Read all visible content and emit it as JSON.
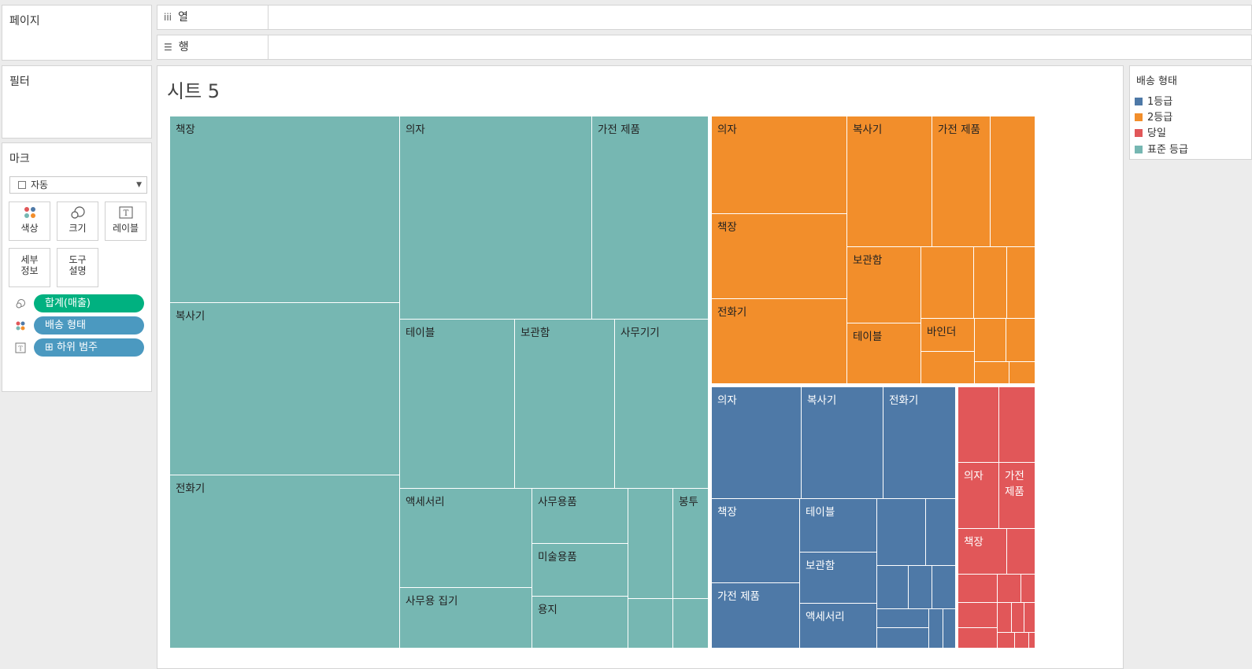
{
  "panels": {
    "pages_title": "페이지",
    "filters_title": "필터",
    "marks_title": "마크"
  },
  "shelves": {
    "columns_label": "열",
    "columns_icon": "iii",
    "rows_label": "행",
    "rows_icon": "☰"
  },
  "marks": {
    "mark_type": "자동",
    "buttons": {
      "color": "색상",
      "size": "크기",
      "label": "레이블",
      "detail_1": "세부",
      "detail_2": "정보",
      "tooltip_1": "도구",
      "tooltip_2": "설명"
    },
    "pills": [
      {
        "icon": "size-icon",
        "text": "합계(매출)",
        "color": "#00b180"
      },
      {
        "icon": "color-icon",
        "text": "배송 형태",
        "color": "#4b99c0"
      },
      {
        "icon": "label-icon",
        "text": "⊞ 하위 범주",
        "color": "#4b99c0"
      }
    ]
  },
  "sheet": {
    "title": "시트 5"
  },
  "legend": {
    "title": "배송 형태",
    "items": [
      {
        "label": "1등급",
        "color": "#4e79a7"
      },
      {
        "label": "2등급",
        "color": "#f28e2b"
      },
      {
        "label": "당일",
        "color": "#e15759"
      },
      {
        "label": "표준 등급",
        "color": "#76b7b2"
      }
    ]
  },
  "chart_data": {
    "type": "treemap",
    "size_measure": "합계(매출)",
    "color_dimension": "배송 형태",
    "label_dimension": "하위 범주",
    "groups": [
      {
        "name": "표준 등급",
        "color": "#76b7b2",
        "labeled_cells": [
          "책장",
          "복사기",
          "전화기",
          "의자",
          "가전 제품",
          "테이블",
          "보관함",
          "사무기기",
          "액세서리",
          "사무용품",
          "미술용품",
          "사무용 집기",
          "용지",
          "봉투"
        ]
      },
      {
        "name": "2등급",
        "color": "#f28e2b",
        "labeled_cells": [
          "의자",
          "책장",
          "전화기",
          "복사기",
          "가전 제품",
          "보관함",
          "테이블",
          "바인더"
        ]
      },
      {
        "name": "1등급",
        "color": "#4e79a7",
        "labeled_cells": [
          "의자",
          "복사기",
          "전화기",
          "책장",
          "테이블",
          "보관함",
          "가전 제품",
          "액세서리"
        ]
      },
      {
        "name": "당일",
        "color": "#e15759",
        "labeled_cells": [
          "의자",
          "가전 제품",
          "책장"
        ]
      }
    ],
    "cell_labels": [
      "책장",
      "복사기",
      "전화기",
      "의자",
      "가전 제품",
      "테이블",
      "보관함",
      "사무기기",
      "액세서리",
      "사무용품",
      "미술용품",
      "사무용 집기",
      "용지",
      "봉투",
      "의자",
      "책장",
      "전화기",
      "복사기",
      "가전 제품",
      "보관함",
      "테이블",
      "바인더",
      "의자",
      "복사기",
      "전화기",
      "책장",
      "테이블",
      "보관함",
      "가전 제품",
      "액세서리",
      "의자",
      "가전 제품",
      "책장"
    ]
  }
}
